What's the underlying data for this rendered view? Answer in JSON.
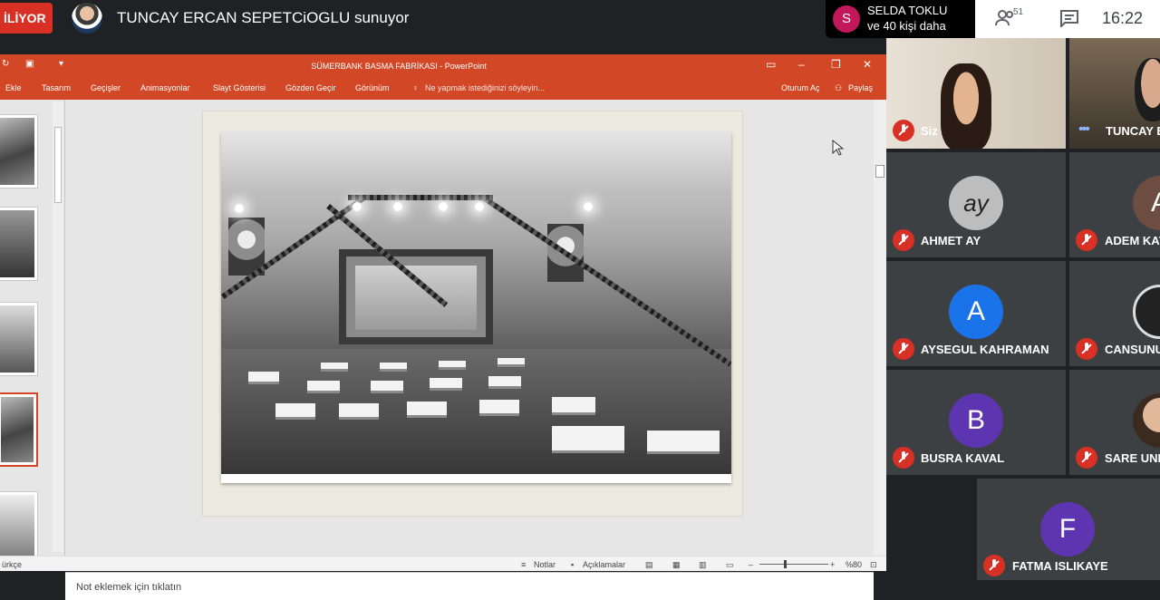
{
  "meet": {
    "present_label": "İLİYOR",
    "presenter_text": "TUNCAY ERCAN SEPETCiOGLU sunuyor",
    "notification": {
      "avatar_letter": "S",
      "line1": "SELDA TOKLU",
      "line2": "ve 40 kişi daha",
      "avatar_color": "#c2185b"
    },
    "people_count": "51",
    "time": "16:22",
    "icons": [
      "people-icon",
      "chat-icon",
      "mic-off-icon"
    ]
  },
  "powerpoint": {
    "title": "SÜMERBANK BASMA FABRİKASI - PowerPoint",
    "accent": "#d24726",
    "ribbon_tabs": [
      "Ekle",
      "Tasarım",
      "Geçişler",
      "Animasyonlar",
      "Slayt Gösterisi",
      "Gözden Geçir",
      "Görünüm"
    ],
    "tell_me": "Ne yapmak istediğinizi söyleyin...",
    "sign_in": "Oturum Aç",
    "share": "Paylaş",
    "notes_placeholder": "Not eklemek için tıklatın",
    "status": {
      "language": "ürkçe",
      "notes": "Notlar",
      "comments": "Açıklamalar",
      "zoom": "%80"
    }
  },
  "participants": [
    {
      "name": "Siz"
    },
    {
      "name": "TUNCAY E"
    },
    {
      "name": "AHMET AY",
      "avatar": "ay"
    },
    {
      "name": "ADEM KAY",
      "avatar": "A"
    },
    {
      "name": "AYSEGUL KAHRAMAN",
      "avatar": "A",
      "color": "#1a73e8"
    },
    {
      "name": "CANSUNU"
    },
    {
      "name": "BUSRA KAVAL",
      "avatar": "B",
      "color": "#5e35b1"
    },
    {
      "name": "SARE UNL"
    },
    {
      "name": "FATMA ISLIKAYE",
      "avatar": "F",
      "color": "#5e35b1"
    }
  ]
}
